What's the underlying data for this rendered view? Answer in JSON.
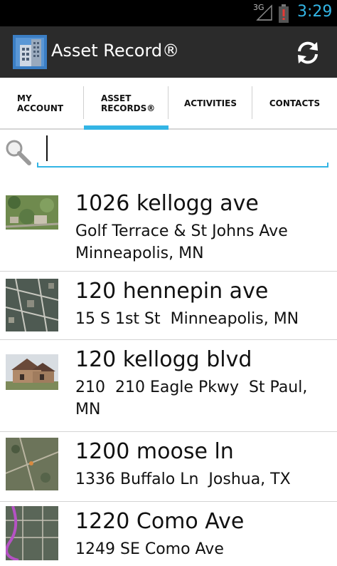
{
  "status_bar": {
    "network": "3G",
    "time": "3:29",
    "signal_icon": "signal-icon",
    "battery_icon": "battery-alert-icon",
    "accent_color": "#33b5e5"
  },
  "action_bar": {
    "title": "Asset Record®",
    "app_icon": "building-icon",
    "refresh_icon": "refresh-icon"
  },
  "tabs": [
    {
      "label": "MY\nACCOUNT",
      "selected": false
    },
    {
      "label": "ASSET\nRECORDS®",
      "selected": true
    },
    {
      "label": "ACTIVITIES",
      "selected": false
    },
    {
      "label": "CONTACTS",
      "selected": false
    }
  ],
  "search": {
    "value": "",
    "placeholder": "",
    "icon": "magnifier-icon"
  },
  "records": [
    {
      "title": "1026 kellogg ave",
      "subtitle": "Golf Terrace & St Johns Ave\nMinneapolis, MN",
      "thumb": "aerial-green"
    },
    {
      "title": "120 hennepin ave",
      "subtitle": "15 S 1st St  Minneapolis, MN",
      "thumb": "aerial-city"
    },
    {
      "title": "120 kellogg blvd",
      "subtitle": "210  210 Eagle Pkwy  St Paul,\nMN",
      "thumb": "house-photo"
    },
    {
      "title": "1200 moose ln",
      "subtitle": "1336 Buffalo Ln  Joshua, TX",
      "thumb": "aerial-rural"
    },
    {
      "title": "1220 Como Ave",
      "subtitle": "1249 SE Como Ave",
      "thumb": "aerial-map"
    }
  ]
}
